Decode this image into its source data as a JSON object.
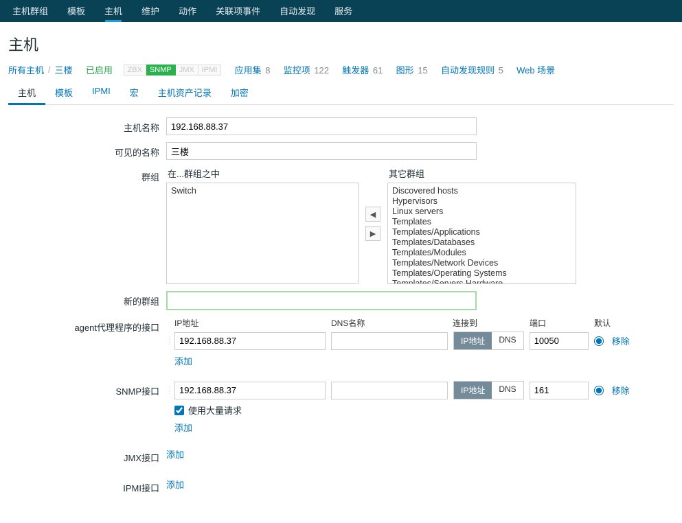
{
  "top_nav": {
    "items": [
      "主机群组",
      "模板",
      "主机",
      "维护",
      "动作",
      "关联项事件",
      "自动发现",
      "服务"
    ],
    "active_index": 2
  },
  "page": {
    "title": "主机"
  },
  "breadcrumb": {
    "all_hosts": "所有主机",
    "current": "三楼",
    "status": "已启用",
    "monitor_tags": {
      "zbx": "ZBX",
      "snmp": "SNMP",
      "jmx": "JMX",
      "ipmi": "IPMI"
    },
    "links": {
      "apps": {
        "label": "应用集",
        "count": "8"
      },
      "items": {
        "label": "监控项",
        "count": "122"
      },
      "triggers": {
        "label": "触发器",
        "count": "61"
      },
      "graphs": {
        "label": "图形",
        "count": "15"
      },
      "discovery": {
        "label": "自动发现规则",
        "count": "5"
      },
      "web": {
        "label": "Web 场景"
      }
    }
  },
  "sub_tabs": [
    "主机",
    "模板",
    "IPMI",
    "宏",
    "主机资产记录",
    "加密"
  ],
  "sub_tabs_active": 0,
  "form": {
    "host_name_label": "主机名称",
    "host_name_value": "192.168.88.37",
    "visible_name_label": "可见的名称",
    "visible_name_value": "三楼",
    "groups_label": "群组",
    "in_groups_header": "在...群组之中",
    "other_groups_header": "其它群组",
    "in_groups": [
      "Switch"
    ],
    "other_groups": [
      "Discovered hosts",
      "Hypervisors",
      "Linux servers",
      "Templates",
      "Templates/Applications",
      "Templates/Databases",
      "Templates/Modules",
      "Templates/Network Devices",
      "Templates/Operating Systems",
      "Templates/Servers Hardware"
    ],
    "new_group_label": "新的群组",
    "new_group_value": "",
    "agent_label": "agent代理程序的接口",
    "snmp_label": "SNMP接口",
    "jmx_label": "JMX接口",
    "ipmi_label": "IPMI接口",
    "col_ip": "IP地址",
    "col_dns": "DNS名称",
    "col_connect": "连接到",
    "col_port": "端口",
    "col_default": "默认",
    "toggle_ip": "IP地址",
    "toggle_dns": "DNS",
    "remove_label": "移除",
    "add_label": "添加",
    "bulk_label": "使用大量请求",
    "agent_iface": {
      "ip": "192.168.88.37",
      "dns": "",
      "port": "10050"
    },
    "snmp_iface": {
      "ip": "192.168.88.37",
      "dns": "",
      "port": "161"
    }
  }
}
